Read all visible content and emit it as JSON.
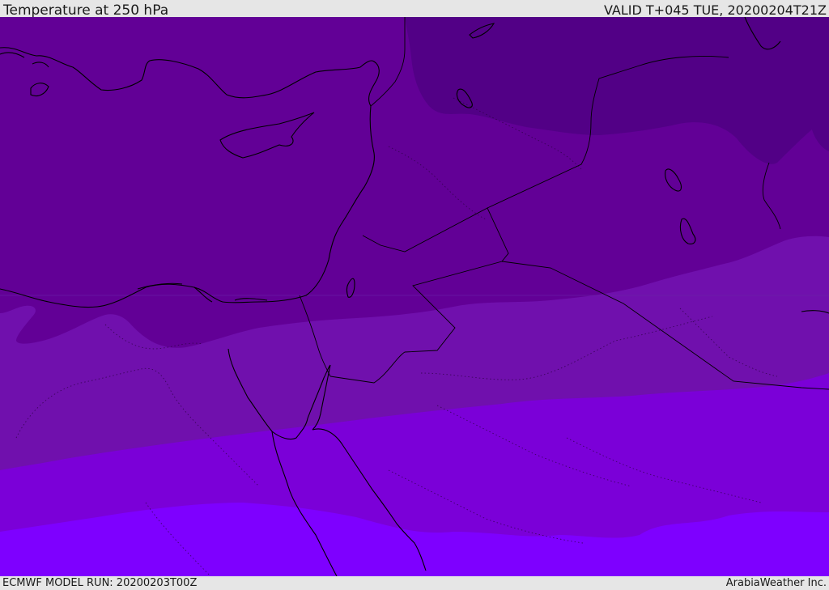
{
  "header": {
    "title": "Temperature at 250 hPa",
    "valid_time": "VALID T+045 TUE, 20200204T21Z"
  },
  "footer": {
    "model_run": "ECMWF MODEL RUN: 20200203T00Z",
    "credit": "ArabiaWeather Inc."
  },
  "colors": {
    "band_coldest": "#520086",
    "band_cold": "#620096",
    "band_mid": "#7010ad",
    "band_warm": "#7b00d8",
    "band_warmest": "#7e00ff",
    "coastline": "#000000",
    "header_bg": "#e6e6e6"
  }
}
